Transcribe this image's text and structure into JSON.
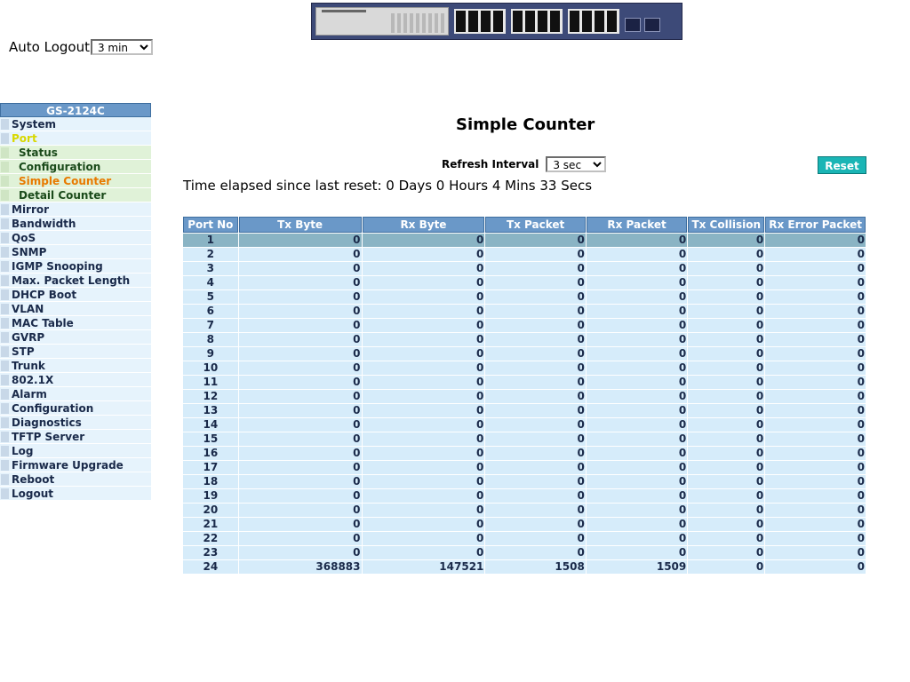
{
  "header": {
    "auto_logout_label": "Auto Logout",
    "auto_logout_value": "3 min"
  },
  "sidebar": {
    "title": "GS-2124C",
    "items": [
      {
        "label": "System"
      },
      {
        "label": "Port",
        "active": true
      },
      {
        "label": "Status",
        "sub": true
      },
      {
        "label": "Configuration",
        "sub": true
      },
      {
        "label": "Simple Counter",
        "sub": true,
        "current": true
      },
      {
        "label": "Detail Counter",
        "sub": true
      },
      {
        "label": "Mirror"
      },
      {
        "label": "Bandwidth"
      },
      {
        "label": "QoS"
      },
      {
        "label": "SNMP"
      },
      {
        "label": "IGMP Snooping"
      },
      {
        "label": "Max. Packet Length"
      },
      {
        "label": "DHCP Boot"
      },
      {
        "label": "VLAN"
      },
      {
        "label": "MAC Table"
      },
      {
        "label": "GVRP"
      },
      {
        "label": "STP"
      },
      {
        "label": "Trunk"
      },
      {
        "label": "802.1X"
      },
      {
        "label": "Alarm"
      },
      {
        "label": "Configuration"
      },
      {
        "label": "Diagnostics"
      },
      {
        "label": "TFTP Server"
      },
      {
        "label": "Log"
      },
      {
        "label": "Firmware Upgrade"
      },
      {
        "label": "Reboot"
      },
      {
        "label": "Logout"
      }
    ]
  },
  "main": {
    "title": "Simple Counter",
    "refresh_label": "Refresh Interval",
    "refresh_value": "3 sec",
    "reset_label": "Reset",
    "elapsed_text": "Time elapsed since last reset: 0 Days 0 Hours 4 Mins 33 Secs"
  },
  "table": {
    "headers": [
      "Port No",
      "Tx Byte",
      "Rx Byte",
      "Tx Packet",
      "Rx Packet",
      "Tx Collision",
      "Rx Error Packet"
    ],
    "rows": [
      [
        "1",
        "0",
        "0",
        "0",
        "0",
        "0",
        "0"
      ],
      [
        "2",
        "0",
        "0",
        "0",
        "0",
        "0",
        "0"
      ],
      [
        "3",
        "0",
        "0",
        "0",
        "0",
        "0",
        "0"
      ],
      [
        "4",
        "0",
        "0",
        "0",
        "0",
        "0",
        "0"
      ],
      [
        "5",
        "0",
        "0",
        "0",
        "0",
        "0",
        "0"
      ],
      [
        "6",
        "0",
        "0",
        "0",
        "0",
        "0",
        "0"
      ],
      [
        "7",
        "0",
        "0",
        "0",
        "0",
        "0",
        "0"
      ],
      [
        "8",
        "0",
        "0",
        "0",
        "0",
        "0",
        "0"
      ],
      [
        "9",
        "0",
        "0",
        "0",
        "0",
        "0",
        "0"
      ],
      [
        "10",
        "0",
        "0",
        "0",
        "0",
        "0",
        "0"
      ],
      [
        "11",
        "0",
        "0",
        "0",
        "0",
        "0",
        "0"
      ],
      [
        "12",
        "0",
        "0",
        "0",
        "0",
        "0",
        "0"
      ],
      [
        "13",
        "0",
        "0",
        "0",
        "0",
        "0",
        "0"
      ],
      [
        "14",
        "0",
        "0",
        "0",
        "0",
        "0",
        "0"
      ],
      [
        "15",
        "0",
        "0",
        "0",
        "0",
        "0",
        "0"
      ],
      [
        "16",
        "0",
        "0",
        "0",
        "0",
        "0",
        "0"
      ],
      [
        "17",
        "0",
        "0",
        "0",
        "0",
        "0",
        "0"
      ],
      [
        "18",
        "0",
        "0",
        "0",
        "0",
        "0",
        "0"
      ],
      [
        "19",
        "0",
        "0",
        "0",
        "0",
        "0",
        "0"
      ],
      [
        "20",
        "0",
        "0",
        "0",
        "0",
        "0",
        "0"
      ],
      [
        "21",
        "0",
        "0",
        "0",
        "0",
        "0",
        "0"
      ],
      [
        "22",
        "0",
        "0",
        "0",
        "0",
        "0",
        "0"
      ],
      [
        "23",
        "0",
        "0",
        "0",
        "0",
        "0",
        "0"
      ],
      [
        "24",
        "368883",
        "147521",
        "1508",
        "1509",
        "0",
        "0"
      ]
    ],
    "selected_row": 0
  }
}
